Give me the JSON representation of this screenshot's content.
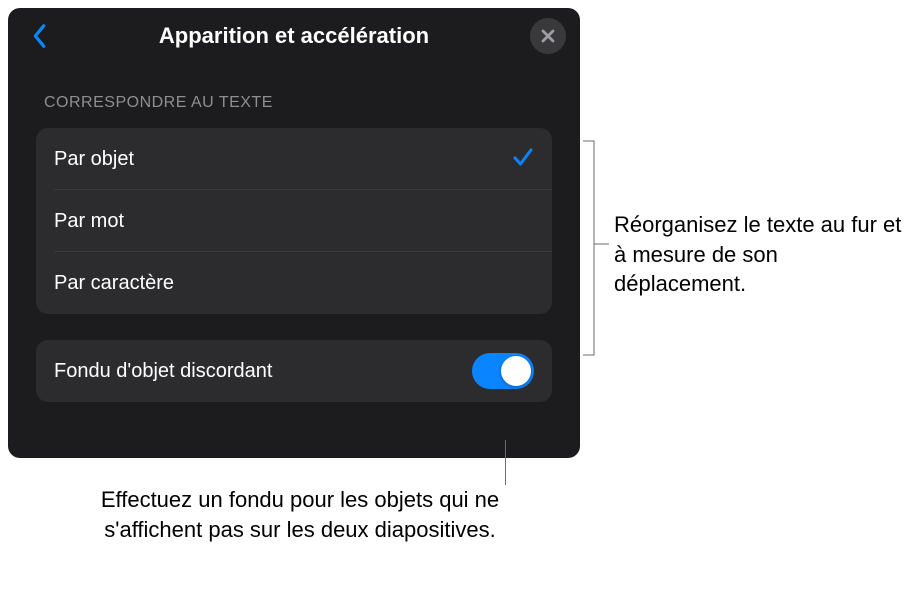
{
  "header": {
    "title": "Apparition et accélération"
  },
  "section": {
    "header": "CORRESPONDRE AU TEXTE"
  },
  "options": [
    {
      "label": "Par objet",
      "selected": true
    },
    {
      "label": "Par mot",
      "selected": false
    },
    {
      "label": "Par caractère",
      "selected": false
    }
  ],
  "toggle": {
    "label": "Fondu d'objet discordant",
    "on": true
  },
  "callouts": {
    "right": "Réorganisez le texte au fur et à mesure de son déplacement.",
    "bottom": "Effectuez un fondu pour les objets qui ne s'affichent pas sur les deux diapositives."
  },
  "colors": {
    "accent": "#0a84ff",
    "panel": "#1c1c1e",
    "group": "#2c2c2e"
  }
}
